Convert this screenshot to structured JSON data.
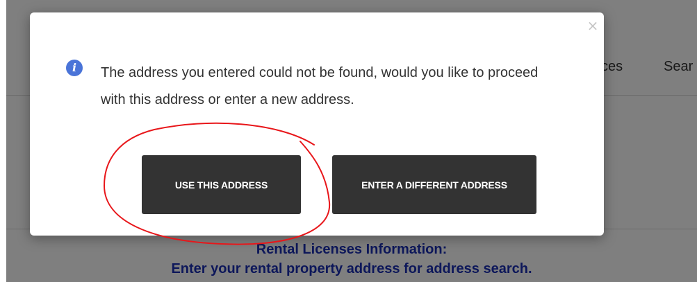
{
  "background": {
    "nav": {
      "services_partial": "ces",
      "search_partial": "Sear"
    },
    "rental": {
      "title": "Rental Licenses Information:",
      "subtitle": "Enter your rental property address for address search."
    }
  },
  "dialog": {
    "close_label": "×",
    "icon": "info-icon",
    "message": "The address you entered could not be found, would you like to proceed with this address or enter a new address.",
    "buttons": {
      "use_this_address": "USE THIS ADDRESS",
      "enter_different_address": "ENTER A DIFFERENT ADDRESS"
    }
  },
  "colors": {
    "button_bg": "#333333",
    "info_icon": "#4a74d8",
    "annotation": "#e8161a",
    "link_text": "#1a2fb4"
  }
}
